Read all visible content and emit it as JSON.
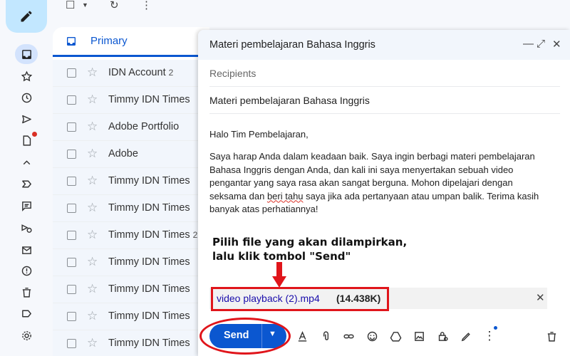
{
  "toolbar": {
    "more_label": "⋮"
  },
  "list": {
    "tab_label": "Primary",
    "rows": [
      {
        "sender": "IDN Account",
        "count": "2"
      },
      {
        "sender": "Timmy IDN Times",
        "count": ""
      },
      {
        "sender": "Adobe Portfolio",
        "count": ""
      },
      {
        "sender": "Adobe",
        "count": ""
      },
      {
        "sender": "Timmy IDN Times",
        "count": ""
      },
      {
        "sender": "Timmy IDN Times",
        "count": ""
      },
      {
        "sender": "Timmy IDN Times",
        "count": "2"
      },
      {
        "sender": "Timmy IDN Times",
        "count": ""
      },
      {
        "sender": "Timmy IDN Times",
        "count": ""
      },
      {
        "sender": "Timmy IDN Times",
        "count": ""
      },
      {
        "sender": "Timmy IDN Times",
        "count": ""
      }
    ]
  },
  "compose": {
    "window_title": "Materi pembelajaran Bahasa Inggris",
    "recipients_placeholder": "Recipients",
    "subject": "Materi pembelajaran Bahasa Inggris",
    "greeting": "Halo Tim Pembelajaran,",
    "body_line1": "Saya harap Anda dalam keadaan baik. Saya ingin berbagi materi pembelajaran",
    "body_line2": "Bahasa Inggris dengan Anda, dan kali ini saya menyertakan sebuah video",
    "body_line3": "pengantar yang saya rasa akan sangat berguna. Mohon dipelajari dengan",
    "body_line4a": "seksama dan ",
    "body_line4b": "beri tahu",
    "body_line4c": " saya jika ada pertanyaan atau umpan balik. Terima kasih",
    "body_line5": "banyak atas perhatiannya!",
    "attachment_name": "video playback (2).mp4",
    "attachment_size": "(14.438K)",
    "send_label": "Send"
  },
  "annotation": {
    "line1": "Pilih file yang akan dilampirkan,",
    "line2": "lalu klik tombol \"Send\""
  },
  "colors": {
    "accent": "#0b57d0",
    "highlight": "#e0151b"
  }
}
